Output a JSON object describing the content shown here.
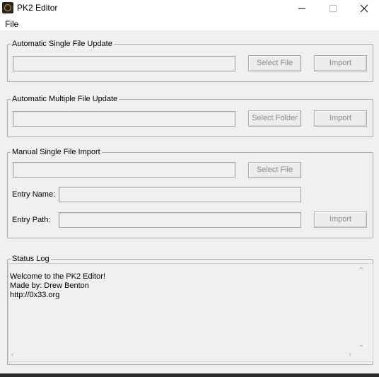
{
  "window": {
    "title": "PK2 Editor",
    "icon": "pk2-app-icon",
    "controls": [
      "minimize-icon",
      "maximize-icon",
      "close-icon"
    ]
  },
  "menu": {
    "items": [
      "File"
    ]
  },
  "groups": {
    "single_update": {
      "legend": "Automatic Single File Update",
      "path_value": "",
      "select_label": "Select File",
      "import_label": "Import"
    },
    "multiple_update": {
      "legend": "Automatic Multiple File Update",
      "path_value": "",
      "select_label": "Select Folder",
      "import_label": "Import"
    },
    "manual_import": {
      "legend": "Manual Single File Import",
      "path_value": "",
      "select_label": "Select File",
      "entry_name_label": "Entry Name:",
      "entry_name_value": "",
      "entry_path_label": "Entry Path:",
      "entry_path_value": "",
      "import_label": "Import"
    },
    "status_log": {
      "legend": "Status Log",
      "lines": [
        "Welcome to the PK2 Editor!",
        "Made by: Drew Benton",
        "http://0x33.org"
      ]
    }
  },
  "colors": {
    "window_bg": "#f0f0f0",
    "titlebar_bg": "#ffffff",
    "disabled_text": "#8c8c8c",
    "border": "#a8a8a8"
  }
}
